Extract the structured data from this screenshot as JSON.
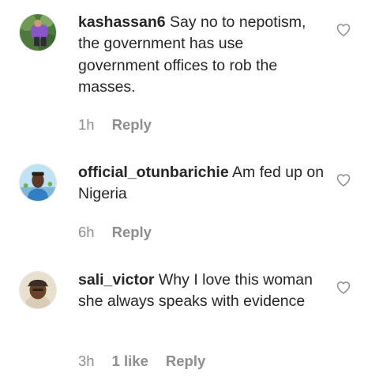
{
  "comments": [
    {
      "username": "kashassan6",
      "text": "Say no to nepotism, the government has use government offices to rob the masses.",
      "time": "1h",
      "likes": "",
      "reply_label": "Reply",
      "avatar_icon": "user-avatar-purple-figure"
    },
    {
      "username": "official_otunbarichie",
      "text": "Am fed up on Nigeria",
      "time": "6h",
      "likes": "",
      "reply_label": "Reply",
      "avatar_icon": "user-avatar-man-blue-sky"
    },
    {
      "username": "sali_victor",
      "text": "Why I love this woman she always speaks with evidence",
      "time": "3h",
      "likes": "1 like",
      "reply_label": "Reply",
      "avatar_icon": "user-avatar-man-cap"
    }
  ],
  "colors": {
    "text": "#262626",
    "meta": "#8e8e8e",
    "heart_outline": "#8e8e8e",
    "background": "#ffffff"
  }
}
